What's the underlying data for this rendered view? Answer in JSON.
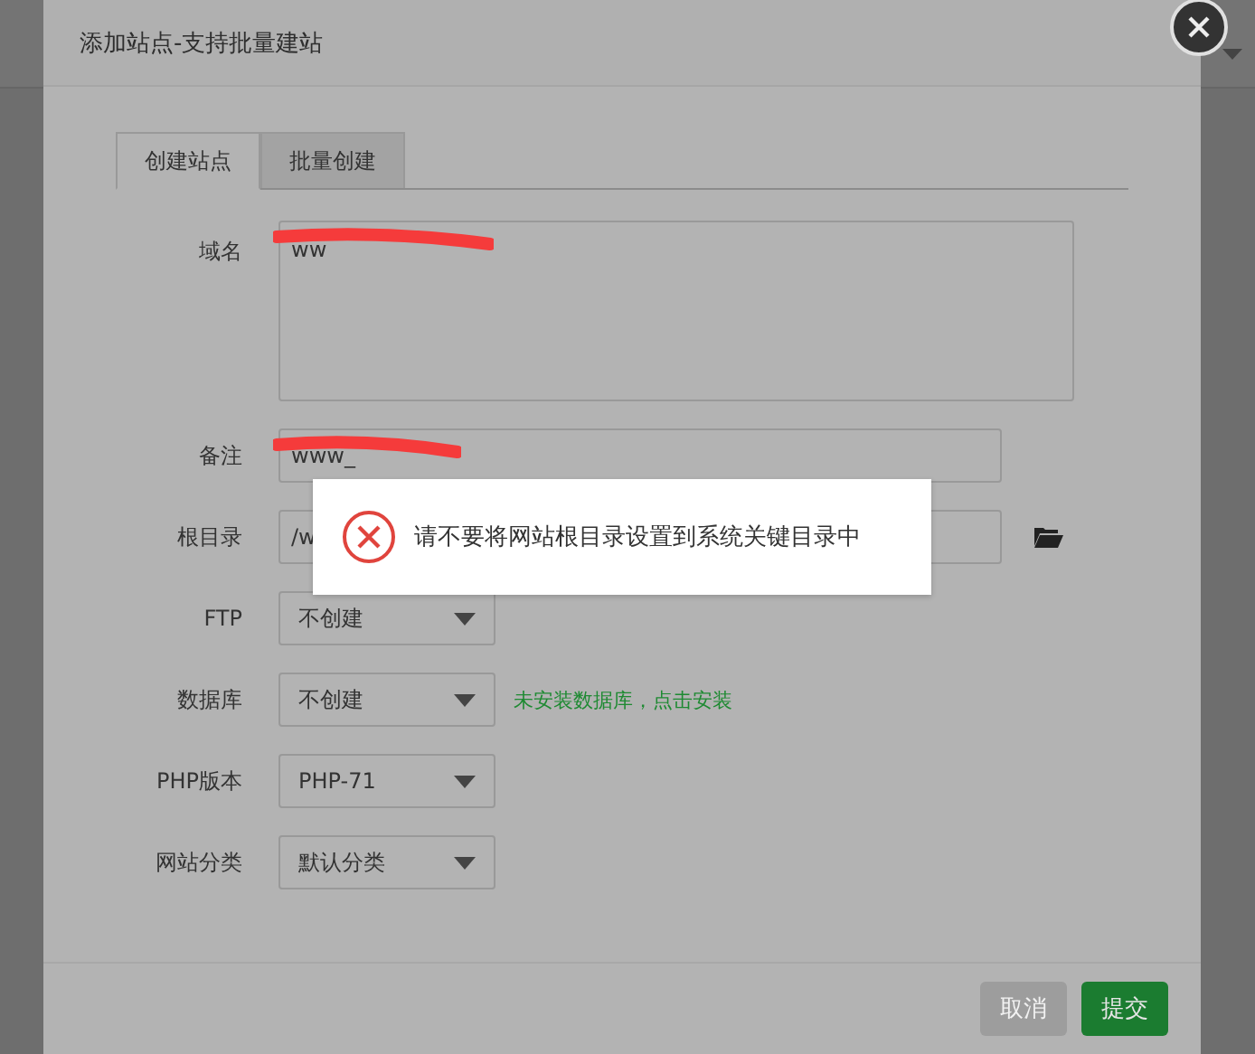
{
  "dialog": {
    "title": "添加站点-支持批量建站"
  },
  "tabs": [
    {
      "label": "创建站点",
      "selected": true
    },
    {
      "label": "批量创建",
      "selected": false
    }
  ],
  "form": [
    {
      "kind": "textarea",
      "label": "域名",
      "value": "ww"
    },
    {
      "kind": "input",
      "label": "备注",
      "value": "www_"
    },
    {
      "kind": "path",
      "label": "根目录",
      "value": "/w"
    },
    {
      "kind": "select",
      "label": "FTP",
      "value": "不创建"
    },
    {
      "kind": "select",
      "label": "数据库",
      "value": "不创建",
      "hint": "未安装数据库，点击安装"
    },
    {
      "kind": "select",
      "label": "PHP版本",
      "value": "PHP-71"
    },
    {
      "kind": "select",
      "label": "网站分类",
      "value": "默认分类"
    }
  ],
  "toast": {
    "message": "请不要将网站根目录设置到系统关键目录中"
  },
  "buttons": [
    {
      "label": "取消",
      "kind": "cancel"
    },
    {
      "label": "提交",
      "kind": "submit"
    }
  ]
}
